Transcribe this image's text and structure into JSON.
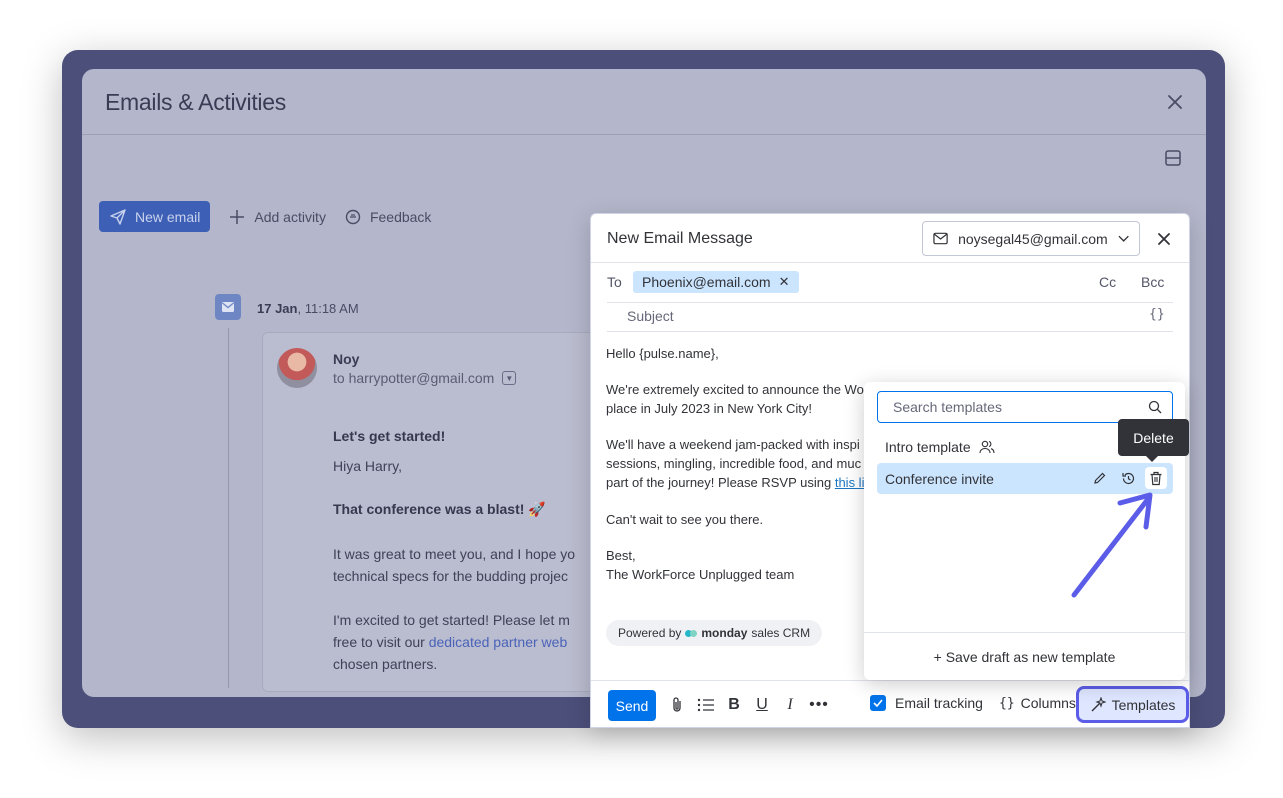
{
  "modal": {
    "title": "Emails & Activities",
    "toolbar": {
      "new_email": "New email",
      "add_activity": "Add activity",
      "feedback": "Feedback"
    }
  },
  "timeline": {
    "date_bold": "17 Jan",
    "time": ", 11:18 AM",
    "sender": "Noy",
    "to": "to harrypotter@gmail.com",
    "lines": {
      "l1": "Let's get started!",
      "l2": "Hiya Harry,",
      "l3": "That conference was a blast! 🚀",
      "l4": "It was great to meet you, and I hope yo",
      "l5": "technical specs for the budding projec",
      "l6": "I'm excited to get started! Please let m",
      "l7a": "free to visit our ",
      "l7b": "dedicated partner web",
      "l8": "chosen partners."
    }
  },
  "compose": {
    "title": "New Email Message",
    "from_email": "noysegal45@gmail.com",
    "to_label": "To",
    "to_recipient": "Phoenix@email.com",
    "cc": "Cc",
    "bcc": "Bcc",
    "subject_placeholder": "Subject",
    "variables_glyph": "{}",
    "body": {
      "greeting": "Hello {pulse.name},",
      "p1a": "We're extremely excited to announce the Wo",
      "p1b": "place in July 2023 in New York City!",
      "p2a": "We'll have a weekend jam-packed with inspi",
      "p2b": "sessions, mingling, incredible food, and muc",
      "p2c": "part of the journey! Please RSVP using ",
      "p2c_link": "this li",
      "p3": "Can't wait to see you there.",
      "sign1": "Best,",
      "sign2": "The WorkForce Unplugged team"
    },
    "powered": {
      "prefix": "Powered by",
      "brand": "monday",
      "brand_sub": "sales CRM"
    },
    "bottom": {
      "send": "Send",
      "email_tracking": "Email tracking",
      "columns": "Columns",
      "columns_glyph": "{}",
      "templates": "Templates"
    }
  },
  "templates_popover": {
    "search_placeholder": "Search templates",
    "items": [
      {
        "label": "Intro template"
      },
      {
        "label": "Conference invite"
      }
    ],
    "save_draft": "+ Save draft as new template",
    "tooltip": "Delete"
  },
  "colors": {
    "primary": "#0073ea",
    "highlight": "#5b5de8",
    "selected_row": "#cce5ff",
    "overlay": "#4c4f7a"
  }
}
